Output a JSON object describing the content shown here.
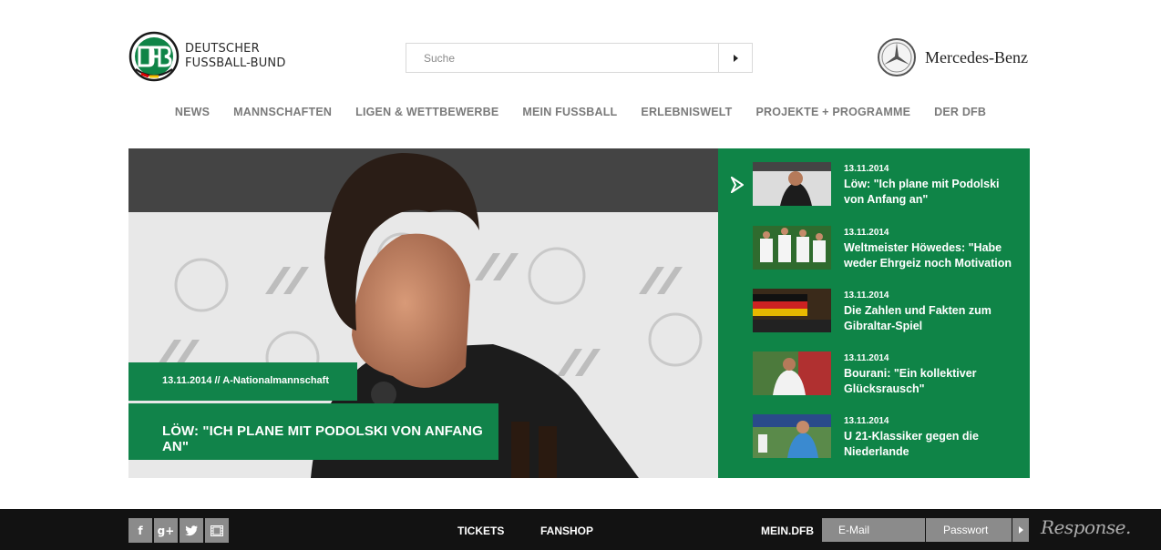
{
  "header": {
    "logo_line1": "DEUTSCHER",
    "logo_line2": "FUSSBALL-BUND",
    "search_placeholder": "Suche",
    "sponsor_name": "Mercedes-Benz"
  },
  "nav": {
    "items": [
      "NEWS",
      "MANNSCHAFTEN",
      "LIGEN & WETTBEWERBE",
      "MEIN FUSSBALL",
      "ERLEBNISWELT",
      "PROJEKTE + PROGRAMME",
      "DER DFB"
    ]
  },
  "hero": {
    "tag": "13.11.2014 // A-Nationalmannschaft",
    "headline": "LÖW: \"ICH PLANE MIT PODOLSKI VON ANFANG AN\"",
    "photo_sponsor": "Mercedes-Benz"
  },
  "news": [
    {
      "date": "13.11.2014",
      "title_line1": "Löw: \"Ich plane mit Podolski",
      "title_line2": "von Anfang an\""
    },
    {
      "date": "13.11.2014",
      "title_line1": "Weltmeister Höwedes: \"Habe",
      "title_line2": "weder Ehrgeiz noch Motivation"
    },
    {
      "date": "13.11.2014",
      "title_line1": "Die Zahlen und Fakten zum",
      "title_line2": "Gibraltar-Spiel"
    },
    {
      "date": "13.11.2014",
      "title_line1": "Bourani: \"Ein kollektiver",
      "title_line2": "Glücksrausch\""
    },
    {
      "date": "13.11.2014",
      "title_line1": "U 21-Klassiker gegen die",
      "title_line2": "Niederlande"
    }
  ],
  "footer": {
    "social": [
      "facebook-icon",
      "google-plus-icon",
      "twitter-icon",
      "video-icon"
    ],
    "social_glyphs": [
      "f",
      "g+",
      "",
      ""
    ],
    "tickets": "TICKETS",
    "fanshop": "FANSHOP",
    "mein_dfb": "MEIN.DFB",
    "email_placeholder": "E-Mail",
    "password_placeholder": "Passwort",
    "watermark": "Response."
  },
  "colors": {
    "brand_green": "#11834a",
    "footer_bg": "#121212",
    "nav_text": "#7a7a7a"
  }
}
